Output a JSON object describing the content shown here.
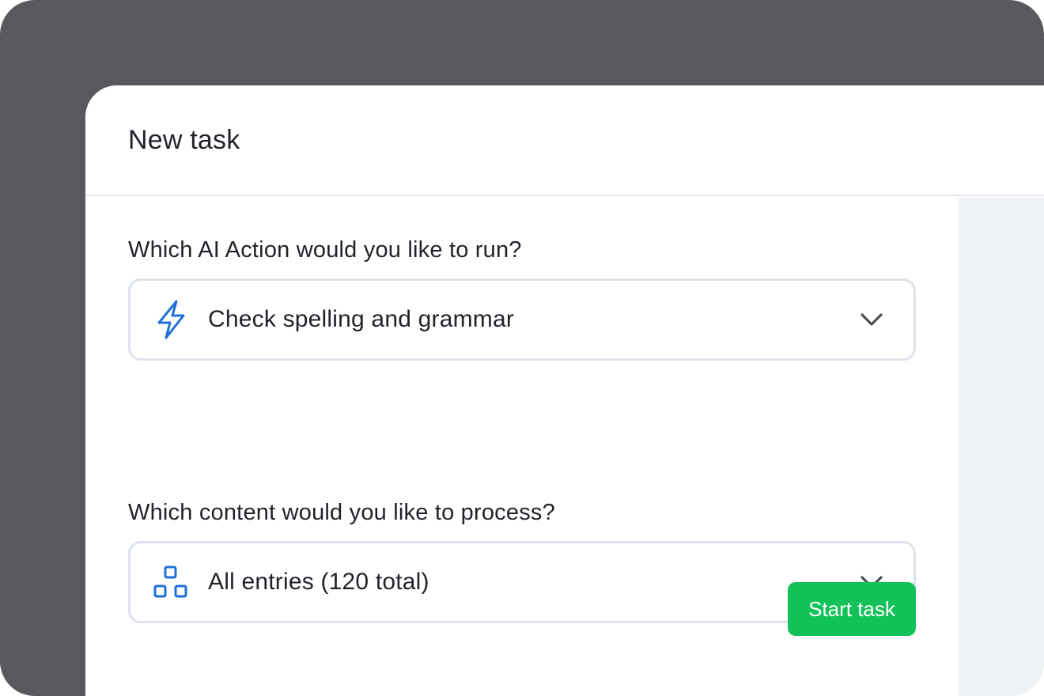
{
  "dialog": {
    "title": "New task"
  },
  "action_field": {
    "label": "Which AI Action would you like to run?",
    "value": "Check spelling and grammar",
    "icon": "lightning-bolt-icon"
  },
  "content_field": {
    "label": "Which content would you like to process?",
    "value": "All entries (120 total)",
    "icon": "entries-blocks-icon"
  },
  "footer": {
    "start_label": "Start task"
  },
  "colors": {
    "accent_blue": "#1f6fd6",
    "primary_green": "#13c159",
    "frame_dark": "#58595d"
  }
}
